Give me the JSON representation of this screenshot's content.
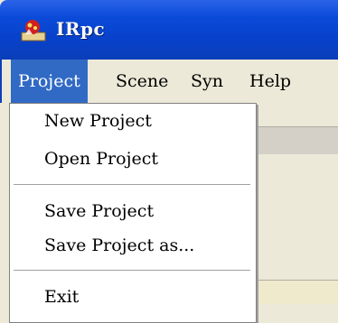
{
  "window": {
    "title": "IRpc",
    "icon": "app-icon"
  },
  "menubar": {
    "items": [
      {
        "label": "Project",
        "active": true
      },
      {
        "label": "Scene"
      },
      {
        "label": "Syn"
      },
      {
        "label": "Help"
      }
    ]
  },
  "project_menu": {
    "new_project": "New Project",
    "open_project": "Open Project",
    "save_project": "Save Project",
    "save_project_as": "Save Project as...",
    "exit": "Exit"
  },
  "colors": {
    "titlebar": "#0a4ad8",
    "menu_highlight": "#316ac5",
    "background": "#ece9d8"
  }
}
